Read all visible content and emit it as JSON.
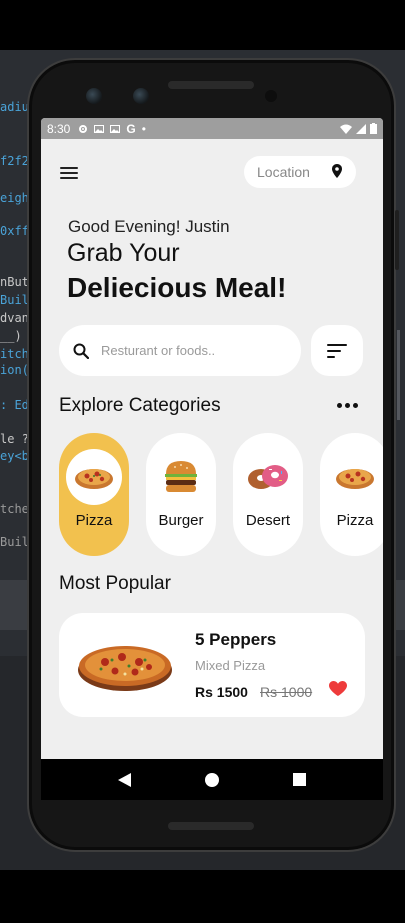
{
  "ide_code_fragments": [
    {
      "text": "adiu",
      "color": "#4aa3d8"
    },
    {
      "text": "f2f2",
      "color": "#4aa3d8"
    },
    {
      "text": "eigh",
      "color": "#4aa3d8"
    },
    {
      "text": "0xff",
      "color": "#4aa3d8"
    },
    {
      "text": "nBut",
      "color": "#c8c8c8"
    },
    {
      "text": "Buil",
      "color": "#4aa3d8"
    },
    {
      "text": "dvan",
      "color": "#c8c8c8"
    },
    {
      "text": "__)",
      "color": "#c8c8c8"
    },
    {
      "text": "itch",
      "color": "#4aa3d8"
    },
    {
      "text": "ion(",
      "color": "#4aa3d8"
    },
    {
      "text": ": Ed",
      "color": "#4aa3d8"
    },
    {
      "text": "le ?",
      "color": "#c8c8c8"
    },
    {
      "text": "ey<b",
      "color": "#4aa3d8"
    },
    {
      "text": "tche",
      "color": "#9a9a9a"
    },
    {
      "text": "Buil",
      "color": "#9a9a9a"
    }
  ],
  "status_bar": {
    "time": "8:30",
    "google_letter": "G",
    "dot": "•"
  },
  "header": {
    "location_label": "Location"
  },
  "greeting": {
    "line1": "Good Evening! Justin",
    "line2": "Grab Your",
    "line3": "Deliecious Meal!"
  },
  "search": {
    "placeholder": "Resturant or foods.."
  },
  "categories": {
    "title": "Explore Categories",
    "items": [
      {
        "label": "Pizza",
        "selected": true
      },
      {
        "label": "Burger",
        "selected": false
      },
      {
        "label": "Desert",
        "selected": false
      },
      {
        "label": "Pizza",
        "selected": false
      }
    ]
  },
  "popular": {
    "title": "Most Popular",
    "item": {
      "name": "5 Peppers",
      "type": "Mixed Pizza",
      "price": "Rs 1500",
      "old_price": "Rs 1000",
      "favorite": true
    }
  },
  "colors": {
    "accent": "#f2c14e",
    "background": "#efefef",
    "card": "#ffffff",
    "heart": "#ee3b3b"
  },
  "icons": [
    "menu-icon",
    "location-pin-icon",
    "search-icon",
    "filter-icon",
    "more-dots-icon",
    "heart-icon",
    "back-icon",
    "home-icon",
    "recents-icon"
  ]
}
